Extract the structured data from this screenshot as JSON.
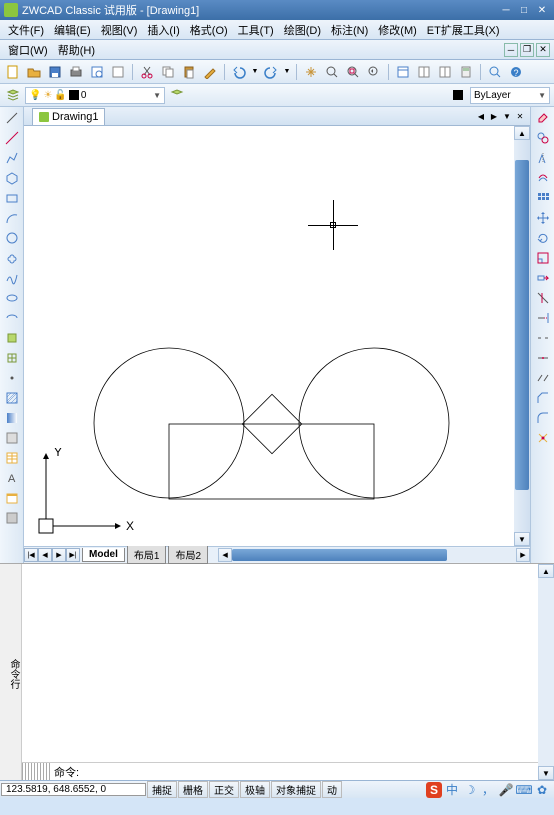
{
  "title": "ZWCAD Classic 试用版 - [Drawing1]",
  "menu": {
    "file": "文件(F)",
    "edit": "编辑(E)",
    "view": "视图(V)",
    "insert": "插入(I)",
    "format": "格式(O)",
    "tools": "工具(T)",
    "draw": "绘图(D)",
    "annotate": "标注(N)",
    "modify": "修改(M)",
    "et": "ET扩展工具(X)",
    "window": "窗口(W)",
    "help": "帮助(H)"
  },
  "layer": {
    "current": "0"
  },
  "bylayer": "ByLayer",
  "doc_tab": "Drawing1",
  "tabs": {
    "model": "Model",
    "layout1": "布局1",
    "layout2": "布局2"
  },
  "cmd": {
    "side": "命令行",
    "prompt": "命令:"
  },
  "status": {
    "coords": "123.5819, 648.6552, 0",
    "snap": "捕捉",
    "grid": "栅格",
    "ortho": "正交",
    "polar": "极轴",
    "osnap": "对象捕捉",
    "dyn": "动"
  },
  "tray": {
    "zh": "中"
  },
  "axes": {
    "x": "X",
    "y": "Y"
  }
}
